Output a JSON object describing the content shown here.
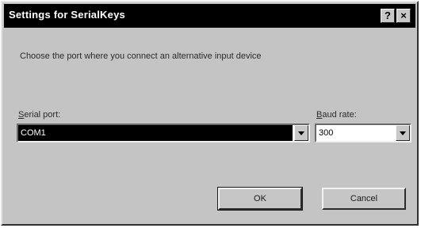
{
  "window": {
    "title": "Settings for SerialKeys"
  },
  "titlebar_buttons": {
    "help": "?",
    "close": "×"
  },
  "prompt": "Choose the port where you connect an alternative input device",
  "serial_port": {
    "label_prefix": "S",
    "label_rest": "erial port:",
    "value": "COM1"
  },
  "baud_rate": {
    "label_prefix": "B",
    "label_rest": "aud rate:",
    "value": "300"
  },
  "buttons": {
    "ok": "OK",
    "cancel": "Cancel"
  }
}
